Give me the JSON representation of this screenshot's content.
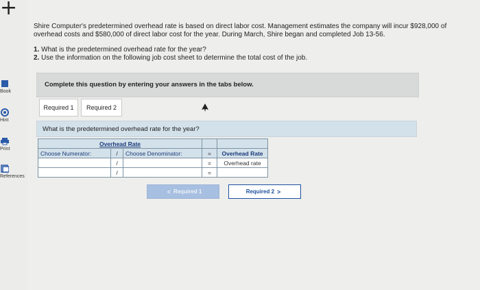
{
  "sidebar": {
    "items": [
      {
        "label": "Book",
        "icon": "book-icon"
      },
      {
        "label": "Hint",
        "icon": "hint-icon"
      },
      {
        "label": "Print",
        "icon": "print-icon"
      },
      {
        "label": "References",
        "icon": "references-icon"
      }
    ]
  },
  "problem": {
    "intro": "Shire Computer's predetermined overhead rate is based on direct labor cost. Management estimates the company will incur $928,000 of overhead costs and $580,000 of direct labor cost for the year. During March, Shire began and completed Job 13-56.",
    "q1_num": "1.",
    "q1_text": "What is the predetermined overhead rate for the year?",
    "q2_num": "2.",
    "q2_text": "Use the information on the following job cost sheet to determine the total cost of the job."
  },
  "instruction": "Complete this question by entering your answers in the tabs below.",
  "tabs": [
    {
      "label": "Required 1"
    },
    {
      "label": "Required 2"
    }
  ],
  "question": "What is the predetermined overhead rate for the year?",
  "table": {
    "title": "Overhead Rate",
    "numerator_label": "Choose Numerator:",
    "divide_sign": "/",
    "denominator_label": "Choose Denominator:",
    "equals_sign": "=",
    "result_header": "Overhead Rate",
    "result_label": "Overhead rate"
  },
  "nav": {
    "prev_label": "Required 1",
    "next_label": "Required 2",
    "prev_chevron": "<",
    "next_chevron": ">"
  },
  "colors": {
    "accent": "#1b4e9e",
    "header_bg": "#d3e1ea"
  }
}
